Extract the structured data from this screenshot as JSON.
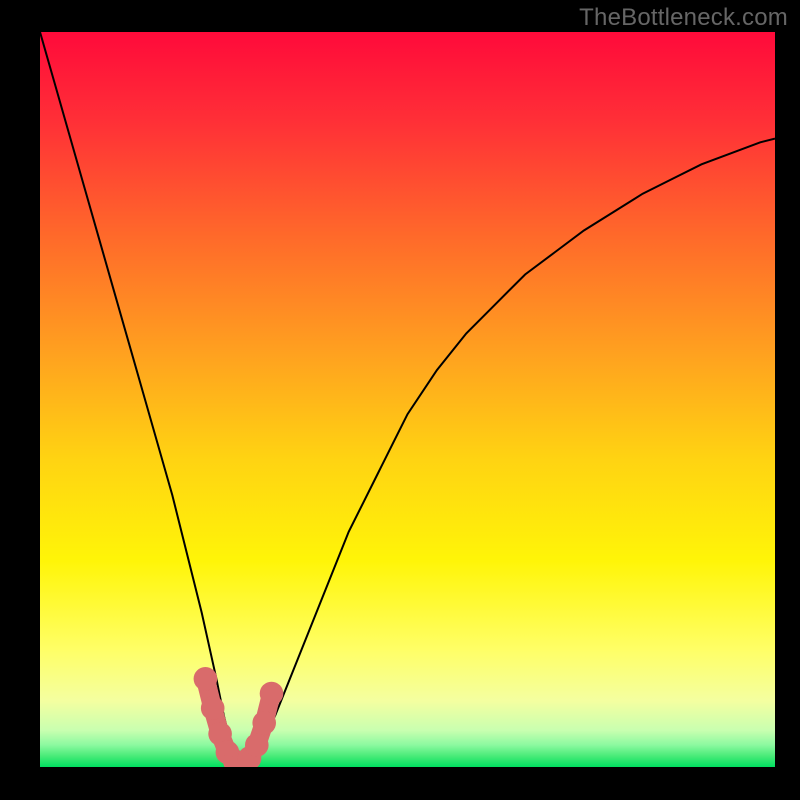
{
  "watermark": {
    "text": "TheBottleneck.com"
  },
  "gradient": {
    "direction": "to bottom",
    "stops": [
      {
        "pct": 0,
        "color": "#ff0a3a"
      },
      {
        "pct": 12,
        "color": "#ff2f37"
      },
      {
        "pct": 28,
        "color": "#ff6a2a"
      },
      {
        "pct": 44,
        "color": "#ffa21f"
      },
      {
        "pct": 58,
        "color": "#ffd312"
      },
      {
        "pct": 72,
        "color": "#fff508"
      },
      {
        "pct": 84,
        "color": "#ffff66"
      },
      {
        "pct": 91,
        "color": "#f4ffa0"
      },
      {
        "pct": 95,
        "color": "#c9ffb0"
      },
      {
        "pct": 97,
        "color": "#8cf9a0"
      },
      {
        "pct": 98.5,
        "color": "#49eb78"
      },
      {
        "pct": 100,
        "color": "#00e060"
      }
    ]
  },
  "chart_data": {
    "type": "line",
    "title": "",
    "xlabel": "",
    "ylabel": "",
    "xlim": [
      0,
      100
    ],
    "ylim": [
      0,
      100
    ],
    "x": [
      0,
      2,
      4,
      6,
      8,
      10,
      12,
      14,
      16,
      18,
      20,
      22,
      24,
      25,
      26,
      27,
      28,
      29,
      30,
      32,
      34,
      36,
      38,
      40,
      42,
      44,
      46,
      48,
      50,
      54,
      58,
      62,
      66,
      70,
      74,
      78,
      82,
      86,
      90,
      94,
      98,
      100
    ],
    "series": [
      {
        "name": "bottleneck-curve",
        "values": [
          100,
          93,
          86,
          79,
          72,
          65,
          58,
          51,
          44,
          37,
          29,
          21,
          12,
          7,
          3,
          1,
          0,
          1,
          3,
          7,
          12,
          17,
          22,
          27,
          32,
          36,
          40,
          44,
          48,
          54,
          59,
          63,
          67,
          70,
          73,
          75.5,
          78,
          80,
          82,
          83.5,
          85,
          85.5
        ]
      }
    ],
    "highlight": {
      "name": "optimal-range",
      "x_range": [
        22.5,
        31.5
      ],
      "points": [
        {
          "x": 22.5,
          "y": 12
        },
        {
          "x": 23.5,
          "y": 8
        },
        {
          "x": 24.5,
          "y": 4.5
        },
        {
          "x": 25.5,
          "y": 2
        },
        {
          "x": 26.5,
          "y": 0.8
        },
        {
          "x": 27.5,
          "y": 0.5
        },
        {
          "x": 28.5,
          "y": 1.2
        },
        {
          "x": 29.5,
          "y": 3
        },
        {
          "x": 30.5,
          "y": 6
        },
        {
          "x": 31.5,
          "y": 10
        }
      ],
      "color": "#d96b6b",
      "point_radius_pct": 1.6
    }
  }
}
